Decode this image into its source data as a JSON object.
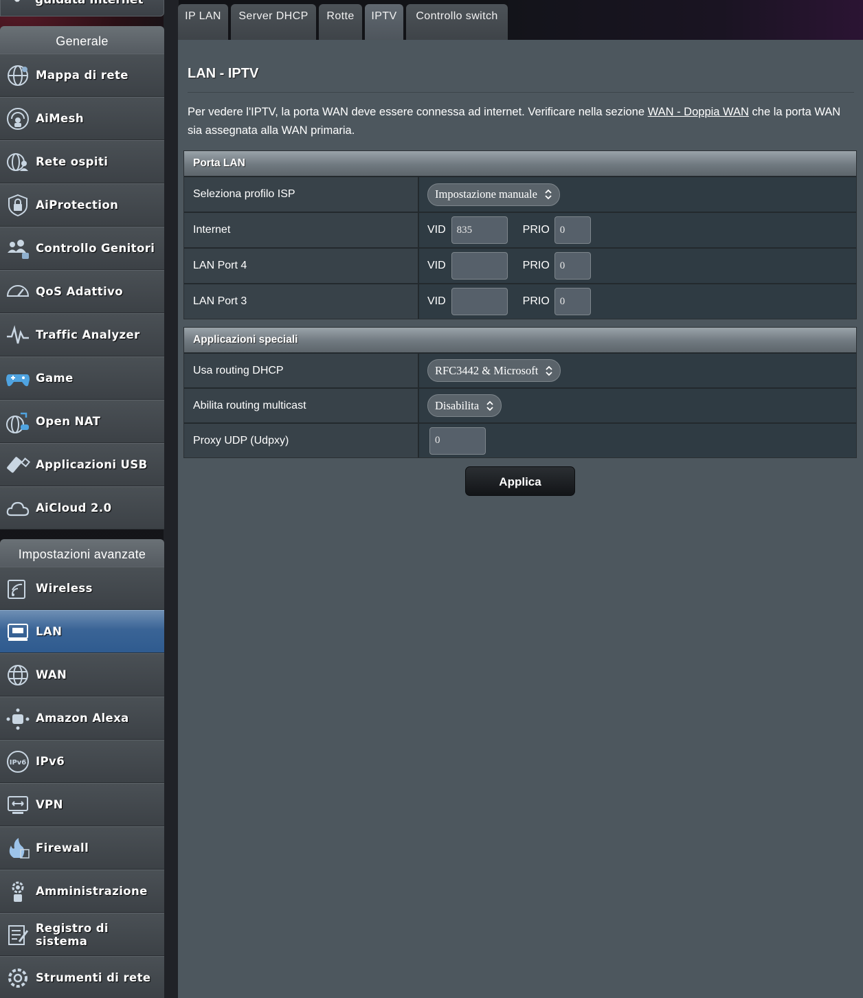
{
  "sidebar": {
    "top_partial_label": "guidata Internet",
    "general_header": "Generale",
    "general_items": [
      {
        "label": "Mappa di rete",
        "icon": "globe-network-icon"
      },
      {
        "label": "AiMesh",
        "icon": "aimesh-icon"
      },
      {
        "label": "Rete ospiti",
        "icon": "guest-network-icon"
      },
      {
        "label": "AiProtection",
        "icon": "shield-lock-icon"
      },
      {
        "label": "Controllo Genitori",
        "icon": "parental-control-icon"
      },
      {
        "label": "QoS Adattivo",
        "icon": "speedometer-icon"
      },
      {
        "label": "Traffic Analyzer",
        "icon": "traffic-analyzer-icon"
      },
      {
        "label": "Game",
        "icon": "gamepad-icon"
      },
      {
        "label": "Open NAT",
        "icon": "open-nat-icon"
      },
      {
        "label": "Applicazioni USB",
        "icon": "usb-icon"
      },
      {
        "label": "AiCloud 2.0",
        "icon": "cloud-icon"
      }
    ],
    "advanced_header": "Impostazioni avanzate",
    "advanced_items": [
      {
        "label": "Wireless",
        "icon": "wireless-icon"
      },
      {
        "label": "LAN",
        "icon": "lan-icon",
        "active": true
      },
      {
        "label": "WAN",
        "icon": "wan-globe-icon"
      },
      {
        "label": "Amazon Alexa",
        "icon": "alexa-icon"
      },
      {
        "label": "IPv6",
        "icon": "ipv6-icon"
      },
      {
        "label": "VPN",
        "icon": "vpn-icon"
      },
      {
        "label": "Firewall",
        "icon": "firewall-icon"
      },
      {
        "label": "Amministrazione",
        "icon": "administration-icon"
      },
      {
        "label": "Registro di sistema",
        "icon": "system-log-icon"
      },
      {
        "label": "Strumenti di rete",
        "icon": "network-tools-icon"
      }
    ]
  },
  "tabs": [
    {
      "label": "IP LAN"
    },
    {
      "label": "Server DHCP"
    },
    {
      "label": "Rotte"
    },
    {
      "label": "IPTV",
      "active": true
    },
    {
      "label": "Controllo switch"
    }
  ],
  "main": {
    "title": "LAN - IPTV",
    "desc_before": "Per vedere l'IPTV, la porta WAN deve essere connessa ad internet. Verificare nella sezione ",
    "desc_link": "WAN - Doppia WAN",
    "desc_after": " che la porta WAN sia assegnata alla WAN primaria.",
    "porta_lan": {
      "header": "Porta LAN",
      "isp_label": "Seleziona profilo ISP",
      "isp_value": "Impostazione manuale",
      "vid_label": "VID",
      "prio_label": "PRIO",
      "rows": [
        {
          "label": "Internet",
          "vid": "835",
          "prio": "0"
        },
        {
          "label": "LAN Port 4",
          "vid": "",
          "prio": "0"
        },
        {
          "label": "LAN Port 3",
          "vid": "",
          "prio": "0"
        }
      ]
    },
    "special_apps": {
      "header": "Applicazioni speciali",
      "dhcp_label": "Usa routing DHCP",
      "dhcp_value": "RFC3442 & Microsoft",
      "multicast_label": "Abilita routing multicast",
      "multicast_value": "Disabilita",
      "udpxy_label": "Proxy UDP (Udpxy)",
      "udpxy_value": "0"
    },
    "apply_label": "Applica"
  }
}
